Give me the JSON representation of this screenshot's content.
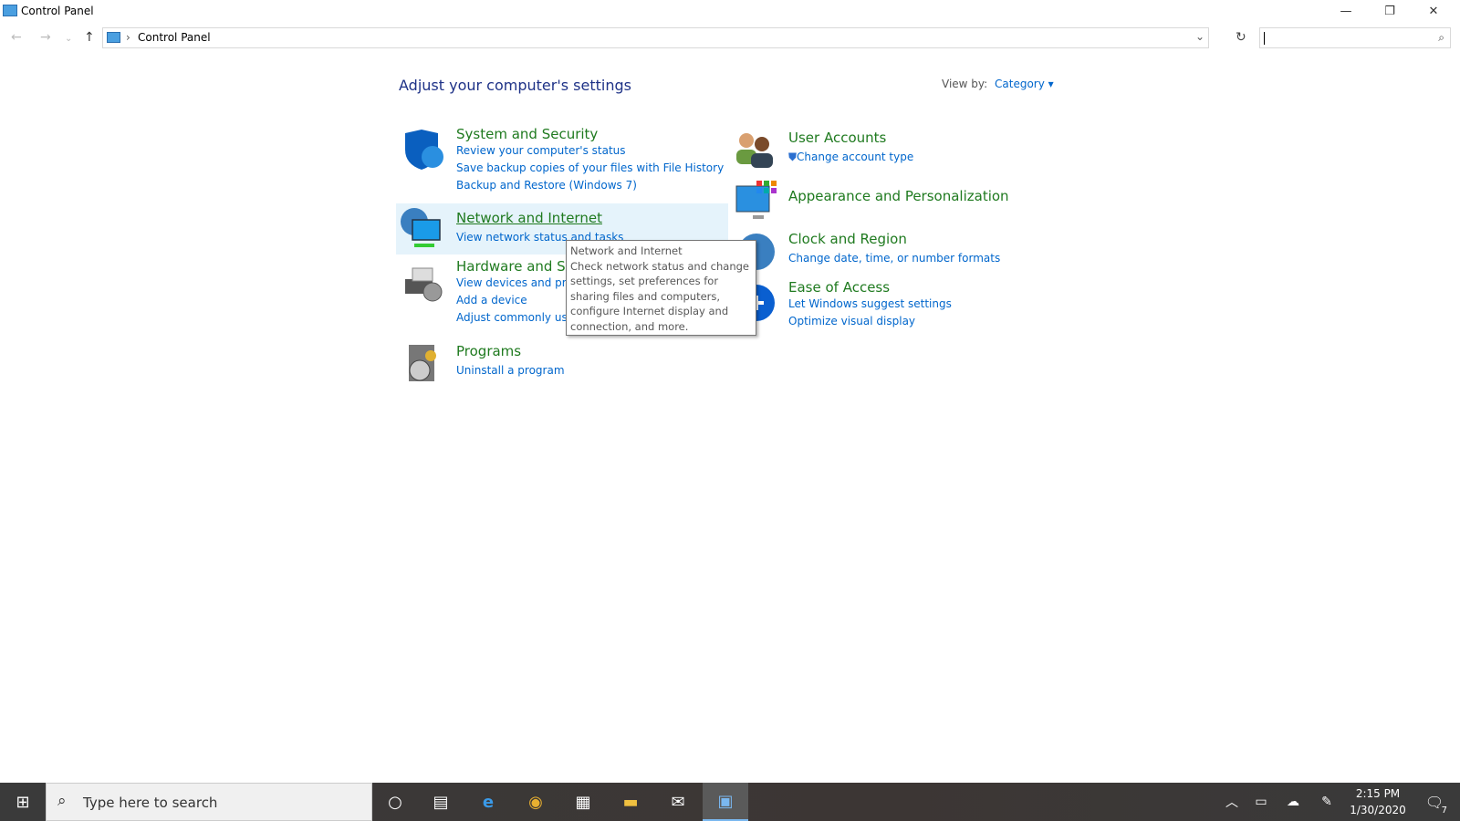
{
  "window": {
    "title": "Control Panel",
    "minimize": "—",
    "restore": "❐",
    "close": "✕"
  },
  "address": {
    "breadcrumb": "Control Panel",
    "search_placeholder": ""
  },
  "main": {
    "heading": "Adjust your computer's settings",
    "view_by_label": "View by:",
    "view_by_value": "Category",
    "left": [
      {
        "title": "System and Security",
        "icon": "shield-icon",
        "links": [
          "Review your computer's status",
          "Save backup copies of your files with File History",
          "Backup and Restore (Windows 7)"
        ]
      },
      {
        "title": "Network and Internet",
        "icon": "network-icon",
        "links": [
          "View network status and tasks"
        ]
      },
      {
        "title": "Hardware and Sound",
        "icon": "printer-icon",
        "links": [
          "View devices and printers",
          "Add a device",
          "Adjust commonly used mobility settings"
        ]
      },
      {
        "title": "Programs",
        "icon": "programs-icon",
        "links": [
          "Uninstall a program"
        ]
      }
    ],
    "right": [
      {
        "title": "User Accounts",
        "icon": "users-icon",
        "links": [
          "Change account type"
        ]
      },
      {
        "title": "Appearance and Personalization",
        "icon": "appearance-icon",
        "links": []
      },
      {
        "title": "Clock and Region",
        "icon": "globe-icon",
        "links": [
          "Change date, time, or number formats"
        ]
      },
      {
        "title": "Ease of Access",
        "icon": "ease-of-access-icon",
        "links": [
          "Let Windows suggest settings",
          "Optimize visual display"
        ]
      }
    ]
  },
  "tooltip": {
    "title": "Network and Internet",
    "body": "Check network status and change settings, set preferences for sharing files and computers, configure Internet display and connection, and more."
  },
  "taskbar": {
    "search_placeholder": "Type here to search",
    "time": "2:15 PM",
    "date": "1/30/2020",
    "notifications": "7"
  }
}
